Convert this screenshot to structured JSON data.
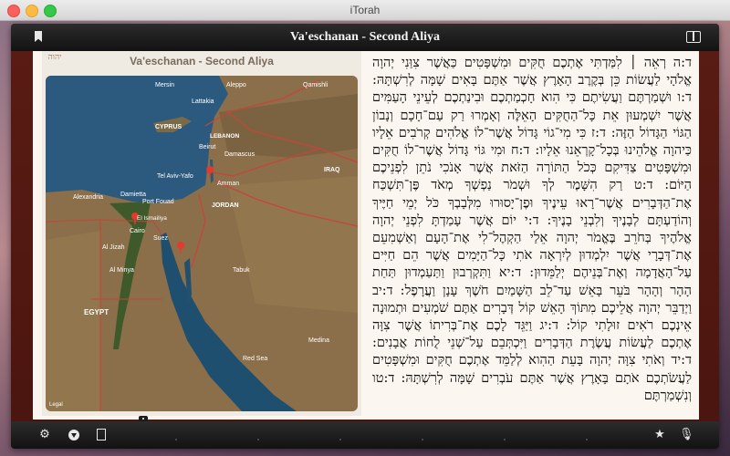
{
  "window": {
    "title": "iTorah"
  },
  "toolbar": {
    "title": "Va'eschanan - Second Aliya"
  },
  "map_panel": {
    "title": "Va'eschanan - Second Aliya",
    "logo_text": "יהוה",
    "legal": "Legal",
    "labels": {
      "cyprus": "CYPRUS",
      "lattakia": "Lattakia",
      "lebanon": "LEBANON",
      "beirut": "Beirut",
      "damascus": "Damascus",
      "tel_aviv": "Tel Aviv-Yafo",
      "amman": "Amman",
      "jordan": "JORDAN",
      "alexandria": "Alexandria",
      "port_said": "Port Fouad",
      "damietta": "Damietta",
      "ismailia": "El Ismailiya",
      "giza": "Al Jizah",
      "suez": "Suez",
      "cairo": "Cairo",
      "al_minya": "Al Minya",
      "egypt": "EGYPT",
      "tabuk": "Tabuk",
      "red_sea": "Red Sea",
      "iraq": "IRAQ",
      "aleppo": "Aleppo",
      "mersin": "Mersin",
      "qamishli": "Qamishli",
      "medina": "Medina"
    },
    "colors": {
      "sea": "#2c5a7e",
      "land": "#8a6f4a",
      "border": "#c8443a",
      "pin": "#e23a2e"
    }
  },
  "text": {
    "body": "ד:ה רְאֵה ׀ לִמַּדְתִּי אֶתְכֶם חֻקִּים וּמִשְׁפָּטִים כַּאֲשֶׁר צִוַּנִי יְהוָה אֱלֹהָי לַעֲשׂוֹת כֵּן בְּקֶרֶב הָאָרֶץ אֲשֶׁר אַתֶּם בָּאִים שָׁמָּה לְרִשְׁתָּהּ: ד:ו וּשְׁמַרְתֶּם וַעֲשִׂיתֶם כִּי הִוא חָכְמַתְכֶם וּבִינַתְכֶם לְעֵינֵי הָעַמִּים אֲשֶׁר יִשְׁמְעוּן אֵת כָּל־הַחֻקִּים הָאֵלֶּה וְאָמְרוּ רַק עַם־חָכָם וְנָבוֹן הַגּוֹי הַגָּדוֹל הַזֶּה: ד:ז כִּי מִי־גוֹי גָּדוֹל אֲשֶׁר־לוֹ אֱלֹהִים קְרֹבִים אֵלָיו כַּיהוָה אֱלֹהֵינוּ בְּכָל־קָרְאֵנוּ אֵלָיו: ד:ח וּמִי גּוֹי גָּדוֹל אֲשֶׁר־לוֹ חֻקִּים וּמִשְׁפָּטִים צַדִּיקִם כְּכֹל הַתּוֹרָה הַזֹּאת אֲשֶׁר אָנֹכִי נֹתֵן לִפְנֵיכֶם הַיּוֹם: ד:ט רַק הִשָּׁמֶר לְךָ וּשְׁמֹר נַפְשְׁךָ מְאֹד פֶּן־תִּשְׁכַּח אֶת־הַדְּבָרִים אֲשֶׁר־רָאוּ עֵינֶיךָ וּפֶן־יָסוּרוּ מִלְּבָבְךָ כֹּל יְמֵי חַיֶּיךָ וְהוֹדַעְתָּם לְבָנֶיךָ וְלִבְנֵי בָנֶיךָ: ד:י יוֹם אֲשֶׁר עָמַדְתָּ לִפְנֵי יְהוָה אֱלֹהֶיךָ בְּחֹרֵב בֶּאֱמֹר יְהוָה אֵלַי הַקְהֶל־לִי אֶת־הָעָם וְאַשְׁמִעֵם אֶת־דְּבָרָי אֲשֶׁר יִלְמְדוּן לְיִרְאָה אֹתִי כָּל־הַיָּמִים אֲשֶׁר הֵם חַיִּים עַל־הָאֲדָמָה וְאֶת־בְּנֵיהֶם יְלַמֵּדוּן: ד:יא וַתִּקְרְבוּן וַתַּעַמְדוּן תַּחַת הָהָר וְהָהָר בֹּעֵר בָּאֵשׁ עַד־לֵב הַשָּׁמַיִם חֹשֶׁךְ עָנָן וַעֲרָפֶל: ד:יב וַיְדַבֵּר יְהוָה אֲלֵיכֶם מִתּוֹךְ הָאֵשׁ קוֹל דְּבָרִים אַתֶּם שֹׁמְעִים וּתְמוּנָה אֵינְכֶם רֹאִים זוּלָתִי קוֹל: ד:יג וַיַּגֵּד לָכֶם אֶת־בְּרִיתוֹ אֲשֶׁר צִוָּה אֶתְכֶם לַעֲשׂוֹת עֲשֶׂרֶת הַדְּבָרִים וַיִּכְתְּבֵם עַל־שְׁנֵי לֻחוֹת אֲבָנִים: ד:יד וְאֹתִי צִוָּה יְהוָה בָּעֵת הַהִוא לְלַמֵּד אֶתְכֶם חֻקִּים וּמִשְׁפָּטִים לַעֲשֹׂתְכֶם אֹתָם בָּאָרֶץ אֲשֶׁר אַתֶּם עֹבְרִים שָׁמָּה לְרִשְׁתָּהּ: ד:טו וְנִשְׁמַרְתֶּם"
  },
  "bottombar": {
    "icons": [
      "gear-icon",
      "download-icon",
      "notes-icon",
      "star-icon",
      "mic-icon"
    ],
    "star_glyph": "★",
    "gear_glyph": "⚙",
    "mic_glyph": "🎙"
  }
}
